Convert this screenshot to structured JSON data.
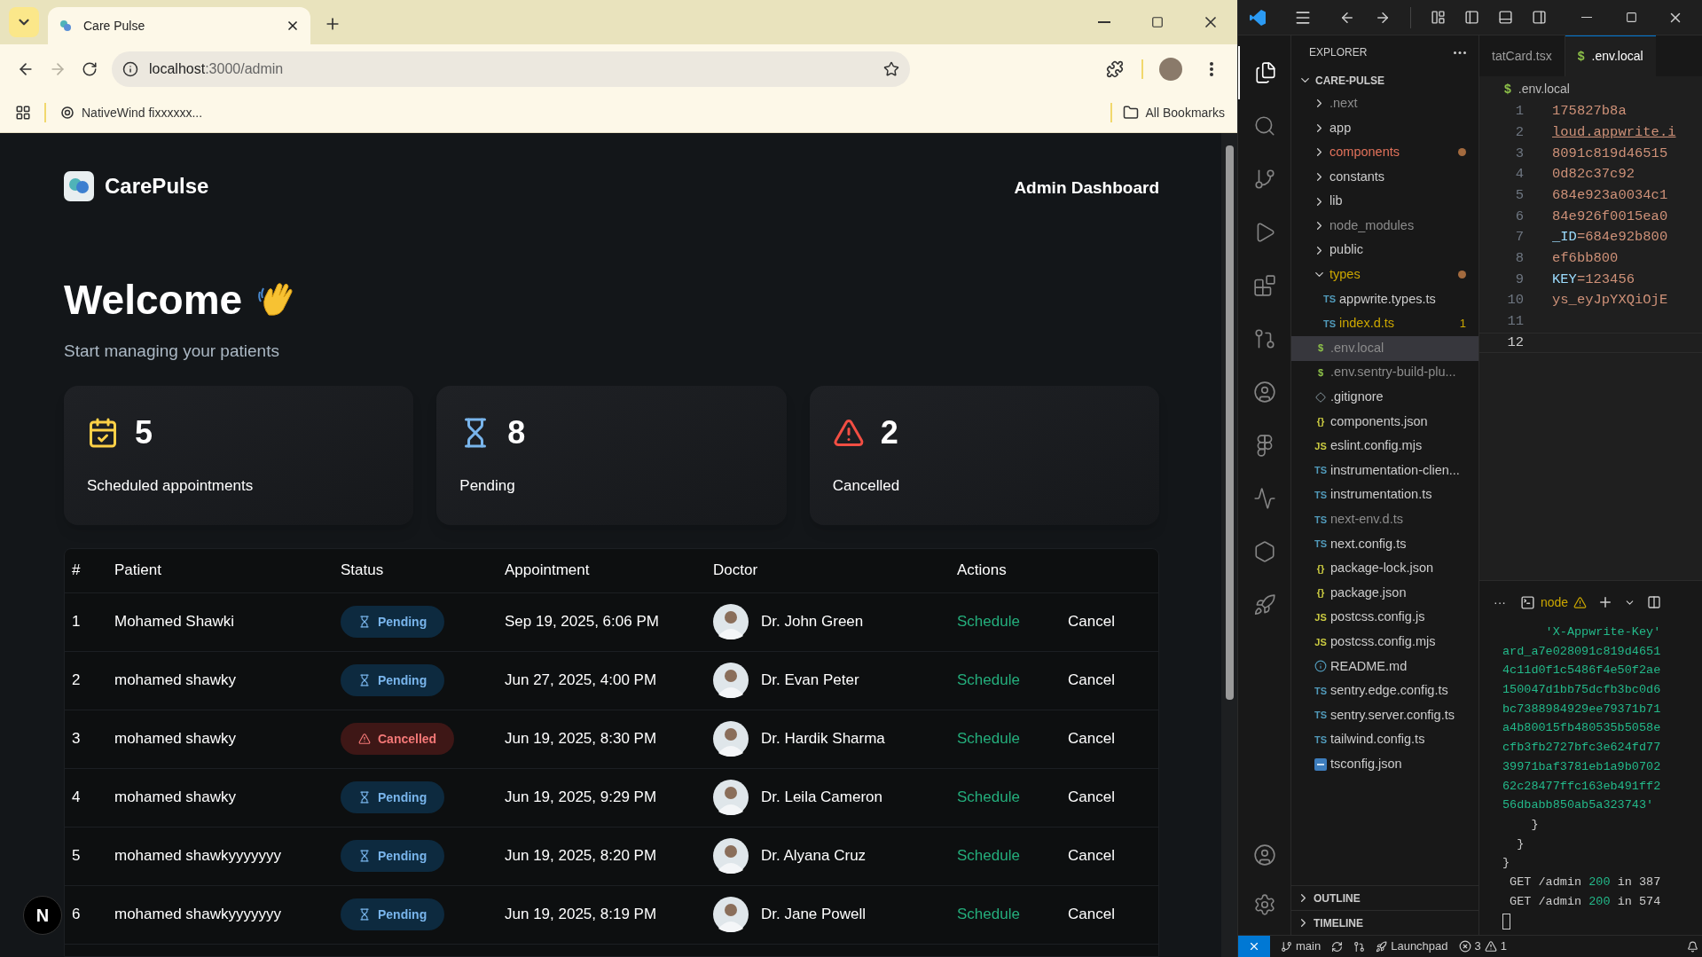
{
  "browser": {
    "tab": {
      "title": "Care Pulse"
    },
    "url": {
      "host": "localhost",
      "path": ":3000/admin"
    },
    "forward_disabled": true,
    "bookmarks": [
      {
        "label": "NativeWind fixxxxxx..."
      }
    ],
    "all_bookmarks": "All Bookmarks"
  },
  "page": {
    "brand": "CarePulse",
    "header_title": "Admin Dashboard",
    "welcome": "Welcome",
    "subtitle": "Start managing your patients",
    "stats": [
      {
        "kind": "scheduled",
        "count": "5",
        "label": "Scheduled appointments"
      },
      {
        "kind": "pending",
        "count": "8",
        "label": "Pending"
      },
      {
        "kind": "cancelled",
        "count": "2",
        "label": "Cancelled"
      }
    ],
    "table": {
      "columns": [
        "#",
        "Patient",
        "Status",
        "Appointment",
        "Doctor",
        "Actions"
      ],
      "rows": [
        {
          "index": "1",
          "patient": "Mohamed Shawki",
          "status": {
            "kind": "pending",
            "label": "Pending"
          },
          "appointment": "Sep 19, 2025, 6:06 PM",
          "doctor": "Dr. John Green",
          "actions": [
            "Schedule",
            "Cancel"
          ]
        },
        {
          "index": "2",
          "patient": "mohamed shawky",
          "status": {
            "kind": "pending",
            "label": "Pending"
          },
          "appointment": "Jun 27, 2025, 4:00 PM",
          "doctor": "Dr. Evan Peter",
          "actions": [
            "Schedule",
            "Cancel"
          ]
        },
        {
          "index": "3",
          "patient": "mohamed shawky",
          "status": {
            "kind": "cancelled",
            "label": "Cancelled"
          },
          "appointment": "Jun 19, 2025, 8:30 PM",
          "doctor": "Dr. Hardik Sharma",
          "actions": [
            "Schedule",
            "Cancel"
          ]
        },
        {
          "index": "4",
          "patient": "mohamed shawky",
          "status": {
            "kind": "pending",
            "label": "Pending"
          },
          "appointment": "Jun 19, 2025, 9:29 PM",
          "doctor": "Dr. Leila Cameron",
          "actions": [
            "Schedule",
            "Cancel"
          ]
        },
        {
          "index": "5",
          "patient": "mohamed shawkyyyyyyy",
          "status": {
            "kind": "pending",
            "label": "Pending"
          },
          "appointment": "Jun 19, 2025, 8:20 PM",
          "doctor": "Dr. Alyana Cruz",
          "actions": [
            "Schedule",
            "Cancel"
          ]
        },
        {
          "index": "6",
          "patient": "mohamed shawkyyyyyyy",
          "status": {
            "kind": "pending",
            "label": "Pending"
          },
          "appointment": "Jun 19, 2025, 8:19 PM",
          "doctor": "Dr. Jane Powell",
          "actions": [
            "Schedule",
            "Cancel"
          ]
        }
      ]
    },
    "dev_indicator": "N"
  },
  "editor": {
    "explorer": {
      "title": "EXPLORER",
      "project": "CARE-PULSE",
      "items": [
        {
          "kind": "folder",
          "name": ".next",
          "color": "#8c8c8c",
          "expanded": false,
          "dot": false,
          "selected": false
        },
        {
          "kind": "folder",
          "name": "app",
          "color": "#cccccc",
          "expanded": false,
          "dot": false,
          "selected": false
        },
        {
          "kind": "folder",
          "name": "components",
          "color": "#e2725b",
          "expanded": false,
          "dot": true,
          "selected": false
        },
        {
          "kind": "folder",
          "name": "constants",
          "color": "#cccccc",
          "expanded": false,
          "dot": false,
          "selected": false
        },
        {
          "kind": "folder",
          "name": "lib",
          "color": "#cccccc",
          "expanded": false,
          "dot": false,
          "selected": false
        },
        {
          "kind": "folder",
          "name": "node_modules",
          "color": "#8c8c8c",
          "expanded": false,
          "dot": false,
          "selected": false
        },
        {
          "kind": "folder",
          "name": "public",
          "color": "#cccccc",
          "expanded": false,
          "dot": false,
          "selected": false
        },
        {
          "kind": "folder",
          "name": "types",
          "color": "#cca700",
          "expanded": true,
          "dot": true,
          "selected": false,
          "children": [
            {
              "kind": "file",
              "name": "appwrite.types.ts",
              "icon": {
                "kind": "ts",
                "glyph": "TS"
              },
              "color": "#cccccc",
              "selected": false
            },
            {
              "kind": "file",
              "name": "index.d.ts",
              "icon": {
                "kind": "ts",
                "glyph": "TS"
              },
              "color": "#cca700",
              "badge": "1",
              "selected": false
            }
          ]
        },
        {
          "kind": "file",
          "name": ".env.local",
          "icon": {
            "kind": "env",
            "glyph": "$"
          },
          "color": "#8c8c8c",
          "selected": true
        },
        {
          "kind": "file",
          "name": ".env.sentry-build-plu...",
          "icon": {
            "kind": "env",
            "glyph": "$"
          },
          "color": "#8c8c8c",
          "selected": false
        },
        {
          "kind": "file",
          "name": ".gitignore",
          "icon": {
            "kind": "git"
          },
          "color": "#cccccc",
          "selected": false
        },
        {
          "kind": "file",
          "name": "components.json",
          "icon": {
            "kind": "json",
            "glyph": "{}"
          },
          "color": "#cccccc",
          "selected": false
        },
        {
          "kind": "file",
          "name": "eslint.config.mjs",
          "icon": {
            "kind": "js",
            "glyph": "JS"
          },
          "color": "#cccccc",
          "selected": false
        },
        {
          "kind": "file",
          "name": "instrumentation-clien...",
          "icon": {
            "kind": "ts",
            "glyph": "TS"
          },
          "color": "#cccccc",
          "selected": false
        },
        {
          "kind": "file",
          "name": "instrumentation.ts",
          "icon": {
            "kind": "ts",
            "glyph": "TS"
          },
          "color": "#cccccc",
          "selected": false
        },
        {
          "kind": "file",
          "name": "next-env.d.ts",
          "icon": {
            "kind": "ts",
            "glyph": "TS"
          },
          "color": "#8c8c8c",
          "selected": false
        },
        {
          "kind": "file",
          "name": "next.config.ts",
          "icon": {
            "kind": "ts",
            "glyph": "TS"
          },
          "color": "#cccccc",
          "selected": false
        },
        {
          "kind": "file",
          "name": "package-lock.json",
          "icon": {
            "kind": "json",
            "glyph": "{}"
          },
          "color": "#cccccc",
          "selected": false
        },
        {
          "kind": "file",
          "name": "package.json",
          "icon": {
            "kind": "json",
            "glyph": "{}"
          },
          "color": "#cccccc",
          "selected": false
        },
        {
          "kind": "file",
          "name": "postcss.config.js",
          "icon": {
            "kind": "js",
            "glyph": "JS"
          },
          "color": "#cccccc",
          "selected": false
        },
        {
          "kind": "file",
          "name": "postcss.config.mjs",
          "icon": {
            "kind": "js",
            "glyph": "JS"
          },
          "color": "#cccccc",
          "selected": false
        },
        {
          "kind": "file",
          "name": "README.md",
          "icon": {
            "kind": "info"
          },
          "color": "#cccccc",
          "selected": false
        },
        {
          "kind": "file",
          "name": "sentry.edge.config.ts",
          "icon": {
            "kind": "ts",
            "glyph": "TS"
          },
          "color": "#cccccc",
          "selected": false
        },
        {
          "kind": "file",
          "name": "sentry.server.config.ts",
          "icon": {
            "kind": "ts",
            "glyph": "TS"
          },
          "color": "#cccccc",
          "selected": false
        },
        {
          "kind": "file",
          "name": "tailwind.config.ts",
          "icon": {
            "kind": "ts",
            "glyph": "TS"
          },
          "color": "#cccccc",
          "selected": false
        },
        {
          "kind": "file",
          "name": "tsconfig.json",
          "icon": {
            "kind": "tsconfig"
          },
          "color": "#cccccc",
          "selected": false
        }
      ]
    },
    "sections": [
      {
        "label": "OUTLINE",
        "expanded": false
      },
      {
        "label": "TIMELINE",
        "expanded": false
      }
    ],
    "tabs": [
      {
        "label": "tatCard.tsx",
        "selected": false
      },
      {
        "label": ".env.local",
        "glyph": "$",
        "selected": true
      }
    ],
    "breadcrumb": {
      "glyph": "$",
      "label": ".env.local"
    },
    "lines": [
      {
        "number": "1",
        "value": "175827b8a",
        "current": false
      },
      {
        "number": "2",
        "value": "loud.appwrite.i",
        "current": false
      },
      {
        "number": "3",
        "value": "8091c819d46515",
        "current": false
      },
      {
        "number": "4",
        "value": "0d82c37c92",
        "current": false
      },
      {
        "number": "5",
        "value": "684e923a0034c1",
        "current": false
      },
      {
        "number": "6",
        "value": "84e926f0015ea0",
        "current": false
      },
      {
        "number": "7",
        "key": "_ID",
        "value": "=684e92b800",
        "current": false
      },
      {
        "number": "8",
        "value": "ef6bb800",
        "current": false
      },
      {
        "number": "9",
        "key": "KEY",
        "value": "=123456",
        "current": false
      },
      {
        "number": "10",
        "value": "ys_eyJpYXQiOjE",
        "current": false
      },
      {
        "number": "11",
        "current": false
      },
      {
        "number": "12",
        "current": true
      }
    ],
    "terminal": {
      "more": "···",
      "name": "node",
      "lines": [
        {
          "kind": "string",
          "text": "      'X-Appwrite-Key'"
        },
        {
          "kind": "string",
          "text": "ard_a7e028091c819d4651"
        },
        {
          "kind": "string",
          "text": "4c11d0f1c5486f4e50f2ae"
        },
        {
          "kind": "string",
          "text": "150047d1bb75dcfb3bc0d6"
        },
        {
          "kind": "string",
          "text": "bc7388984929ee79371b71"
        },
        {
          "kind": "string",
          "text": "a4b80015fb480535b5058e"
        },
        {
          "kind": "string",
          "text": "cfb3fb2727bfc3e624fd77"
        },
        {
          "kind": "string",
          "text": "39971baf3781eb1a9b0702"
        },
        {
          "kind": "string",
          "text": "62c28477ffc163eb491ff2"
        },
        {
          "kind": "string",
          "text": "56dbabb850ab5a323743'"
        },
        {
          "kind": "plain",
          "text": "    }"
        },
        {
          "kind": "plain",
          "text": "  }"
        },
        {
          "kind": "plain",
          "text": "}"
        },
        {
          "kind": "request",
          "text": " GET /admin ",
          "code": "200",
          "rest": " in 387"
        },
        {
          "kind": "request",
          "text": " GET /admin ",
          "code": "200",
          "rest": " in 574"
        }
      ]
    },
    "status_bar": {
      "branch": "main",
      "launchpad": "Launchpad",
      "errors": "3",
      "warnings": "1"
    }
  }
}
